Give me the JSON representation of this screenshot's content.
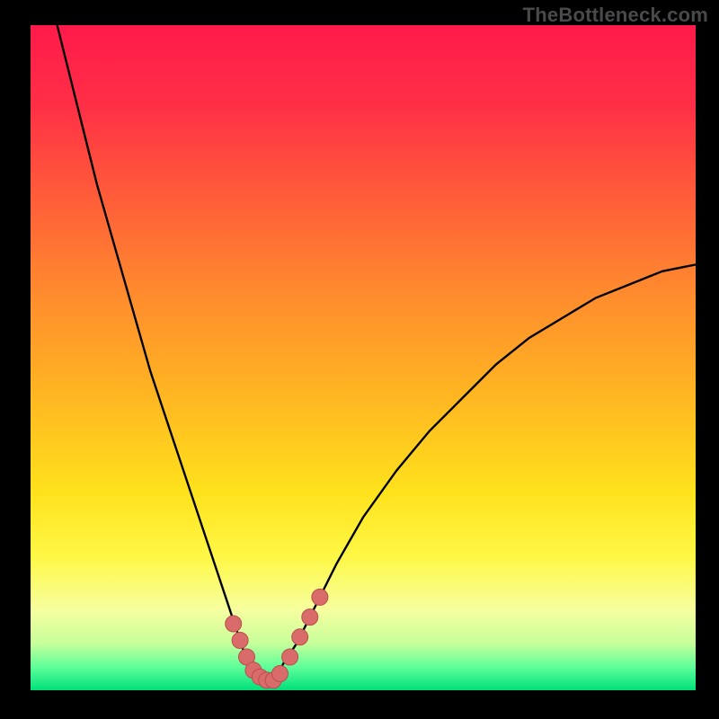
{
  "watermark": "TheBottleneck.com",
  "colors": {
    "frame": "#000000",
    "curve": "#000000",
    "marker_fill": "#d96b6b",
    "marker_stroke": "#b94e4e",
    "gradient_stops": [
      {
        "offset": 0.0,
        "color": "#ff1a4b"
      },
      {
        "offset": 0.12,
        "color": "#ff2f46"
      },
      {
        "offset": 0.25,
        "color": "#ff5a3a"
      },
      {
        "offset": 0.4,
        "color": "#ff8a2e"
      },
      {
        "offset": 0.55,
        "color": "#ffb422"
      },
      {
        "offset": 0.7,
        "color": "#ffe11c"
      },
      {
        "offset": 0.8,
        "color": "#fff846"
      },
      {
        "offset": 0.88,
        "color": "#f6ffa0"
      },
      {
        "offset": 0.93,
        "color": "#c6ff9a"
      },
      {
        "offset": 0.965,
        "color": "#5fff9a"
      },
      {
        "offset": 1.0,
        "color": "#00e07a"
      }
    ]
  },
  "chart_data": {
    "type": "line",
    "title": "",
    "xlabel": "",
    "ylabel": "",
    "xlim": [
      0,
      100
    ],
    "ylim": [
      0,
      100
    ],
    "series": [
      {
        "name": "bottleneck-curve",
        "x": [
          4,
          6,
          8,
          10,
          12,
          14,
          16,
          18,
          20,
          22,
          24,
          26,
          28,
          30,
          32,
          33,
          34,
          35,
          36,
          37,
          38,
          40,
          42,
          44,
          46,
          50,
          55,
          60,
          65,
          70,
          75,
          80,
          85,
          90,
          95,
          100
        ],
        "y": [
          100,
          92,
          84,
          76,
          69,
          62,
          55,
          48,
          42,
          36,
          30,
          24,
          18,
          12,
          6,
          4,
          2,
          1,
          1,
          2,
          4,
          7,
          11,
          15,
          19,
          26,
          33,
          39,
          44,
          49,
          53,
          56,
          59,
          61,
          63,
          64
        ]
      }
    ],
    "markers": {
      "name": "highlighted-points",
      "x": [
        30.5,
        31.5,
        32.5,
        33.5,
        34.5,
        35.5,
        36.5,
        37.5,
        39.0,
        40.5,
        42.0,
        43.5
      ],
      "y": [
        10.0,
        7.5,
        5.0,
        3.0,
        2.0,
        1.5,
        1.5,
        2.5,
        5.0,
        8.0,
        11.0,
        14.0
      ]
    }
  }
}
